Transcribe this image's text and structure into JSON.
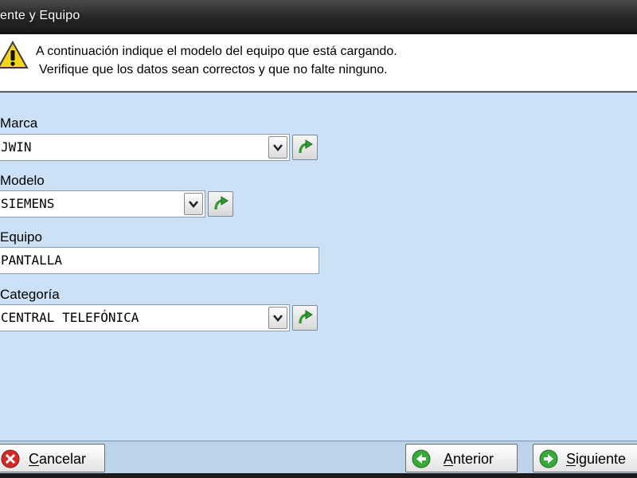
{
  "window": {
    "title": "ente y Equipo"
  },
  "info": {
    "line1": "A continuación indique el modelo del equipo que está cargando.",
    "line2": "Verifique que los datos sean correctos y que no falte ninguno.",
    "icon": "warning-icon"
  },
  "form": {
    "marca": {
      "label": "Marca",
      "value": "JWIN"
    },
    "modelo": {
      "label": "Modelo",
      "value": "SIEMENS"
    },
    "equipo": {
      "label": "Equipo",
      "value": "PANTALLA"
    },
    "categoria": {
      "label": "Categoría",
      "value": "CENTRAL TELEFÓNICA"
    }
  },
  "buttons": {
    "cancel": {
      "label": "Cancelar",
      "icon": "close-icon"
    },
    "back": {
      "label": "Anterior",
      "icon": "arrow-left-icon"
    },
    "next": {
      "label": "Siguiente",
      "icon": "arrow-right-icon"
    }
  },
  "colors": {
    "form_background": "#cde1f6",
    "bottom_bar": "#bcd3ea",
    "go_arrow": "#2e9b2e",
    "cancel_red": "#d12a2a"
  }
}
